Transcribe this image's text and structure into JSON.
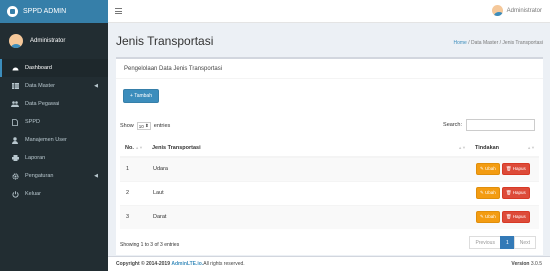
{
  "app": {
    "logo_text": "SPPD ADMIN"
  },
  "sidebar": {
    "user_name": "Administrator",
    "items": [
      {
        "label": "Dashboard",
        "icon": "dashboard-icon"
      },
      {
        "label": "Data Master",
        "icon": "table-icon"
      },
      {
        "label": "Data Pegawai",
        "icon": "users-icon"
      },
      {
        "label": "SPPD",
        "icon": "file-icon"
      },
      {
        "label": "Manajemen User",
        "icon": "user-icon"
      },
      {
        "label": "Laporan",
        "icon": "print-icon"
      },
      {
        "label": "Pengaturan",
        "icon": "cog-icon"
      },
      {
        "label": "Keluar",
        "icon": "power-icon"
      }
    ]
  },
  "topbar": {
    "user_name": "Administrator"
  },
  "header": {
    "title": "Jenis Transportasi",
    "breadcrumb": {
      "home": "Home",
      "sep1": " / ",
      "middle": "Data Master",
      "sep2": " / ",
      "current": "Jenis Transportasi"
    }
  },
  "box": {
    "title": "Pengelolaan Data Jenis Transportasi",
    "add_label": "+ Tambah",
    "show_label": "Show",
    "entries_value": "10",
    "entries_label": "entries",
    "search_label": "Search:",
    "columns": [
      "No.",
      "Jenis Transportasi",
      "Tindakan"
    ],
    "rows": [
      {
        "no": "1",
        "jenis": "Udara"
      },
      {
        "no": "2",
        "jenis": "Laut"
      },
      {
        "no": "3",
        "jenis": "Darat"
      }
    ],
    "edit_label": "Ubah",
    "delete_label": "Hapus",
    "info": "Showing 1 to 3 of 3 entries",
    "pager": {
      "prev": "Previous",
      "page": "1",
      "next": "Next"
    }
  },
  "footer": {
    "prefix": "Copyright © 2014-2019 ",
    "brand": "AdminLTE.io.",
    "suffix": " All rights reserved.",
    "version_label": "Version",
    "version": "3.0.5"
  },
  "colors": {
    "sidebar": "#222d32",
    "logo": "#367fa9",
    "primary": "#3c8dbc",
    "warning": "#f39c12",
    "danger": "#dd4b39"
  }
}
